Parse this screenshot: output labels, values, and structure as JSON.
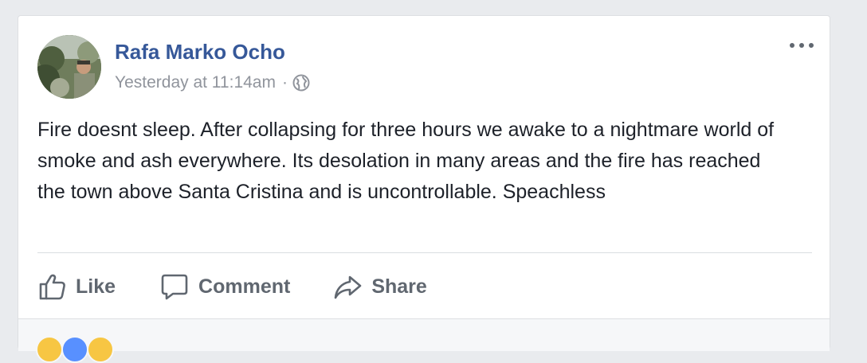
{
  "post": {
    "author": "Rafa Marko Ocho",
    "timestamp": "Yesterday at 11:14am",
    "separator": "·",
    "privacy_icon": "globe-icon",
    "more_icon": "more-horizontal-icon",
    "text": "Fire doesnt sleep. After collapsing for three hours we awake to a nightmare world of smoke and ash everywhere. Its desolation in many areas and the fire has reached the town above Santa Cristina and is uncontrollable. Speachless"
  },
  "actions": {
    "like_label": "Like",
    "comment_label": "Comment",
    "share_label": "Share"
  },
  "colors": {
    "author": "#365899",
    "meta": "#90949c",
    "text": "#1d2129",
    "action": "#606770",
    "background": "#e9ebee"
  }
}
